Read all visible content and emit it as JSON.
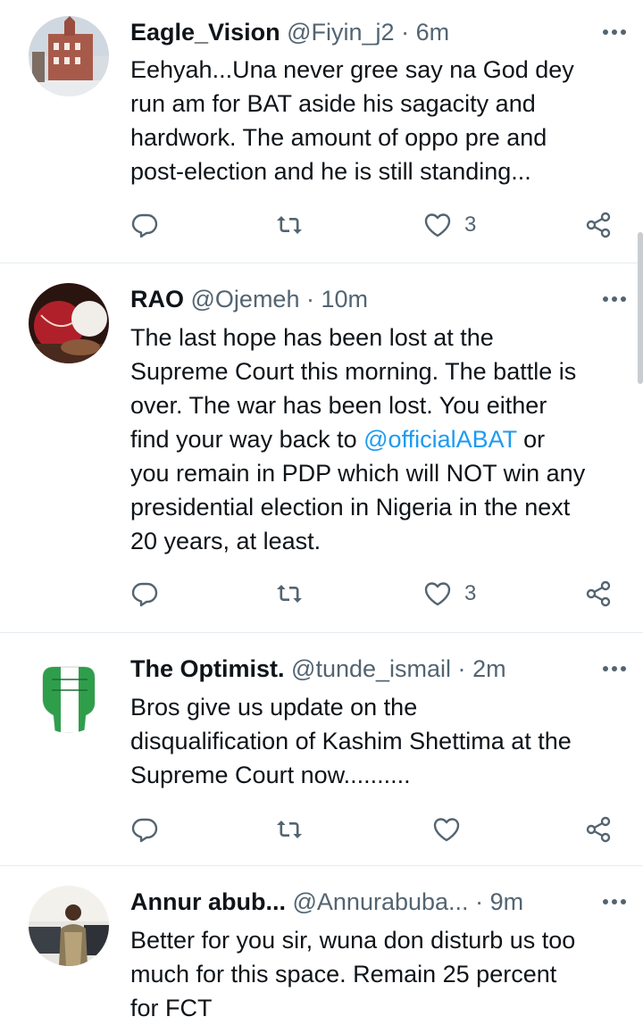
{
  "tweets": [
    {
      "name": "Eagle_Vision",
      "handle": "@Fiyin_j2",
      "sep": "·",
      "time": "6m",
      "avatar_icon": "building-photo-avatar",
      "text_lines": [
        "Eehyah...Una never gree say na God dey",
        "run am for BAT aside his sagacity and",
        "hardwork. The amount of oppo pre and",
        "post-election and he is still standing..."
      ],
      "like_count": "3"
    },
    {
      "name": "RAO",
      "handle": "@Ojemeh",
      "sep": "·",
      "time": "10m",
      "avatar_icon": "cricket-ball-photo-avatar",
      "text_lines": [
        "The last hope has been lost at the",
        "Supreme Court this morning. The battle is",
        "over. The war has been lost. You either",
        "",
        "you remain in PDP which will NOT win any",
        "presidential election in Nigeria in the next",
        "20 years, at least."
      ],
      "line4_pre": "find your way back to ",
      "line4_mention": "@officialABAT",
      "line4_post": " or",
      "like_count": "3"
    },
    {
      "name": "The Optimist.",
      "handle": "@tunde_ismail",
      "sep": "·",
      "time": "2m",
      "avatar_icon": "nigeria-fist-avatar",
      "text_lines": [
        "Bros give us update on the",
        "disqualification of Kashim Shettima at the",
        "Supreme Court now.........."
      ],
      "like_count": ""
    },
    {
      "name": "Annur abub...",
      "handle": "@Annurabuba...",
      "sep": "·",
      "time": "9m",
      "avatar_icon": "person-photo-avatar",
      "text_lines": [
        "Better for you sir, wuna don disturb us too",
        "much for this space. Remain 25 percent",
        "for FCT"
      ]
    }
  ],
  "colors": {
    "text": "#0f1419",
    "secondary": "#536471",
    "link": "#1d9bf0",
    "divider": "#e6ecf0"
  },
  "icons": [
    "reply-icon",
    "retweet-icon",
    "like-icon",
    "share-icon",
    "more-icon"
  ]
}
